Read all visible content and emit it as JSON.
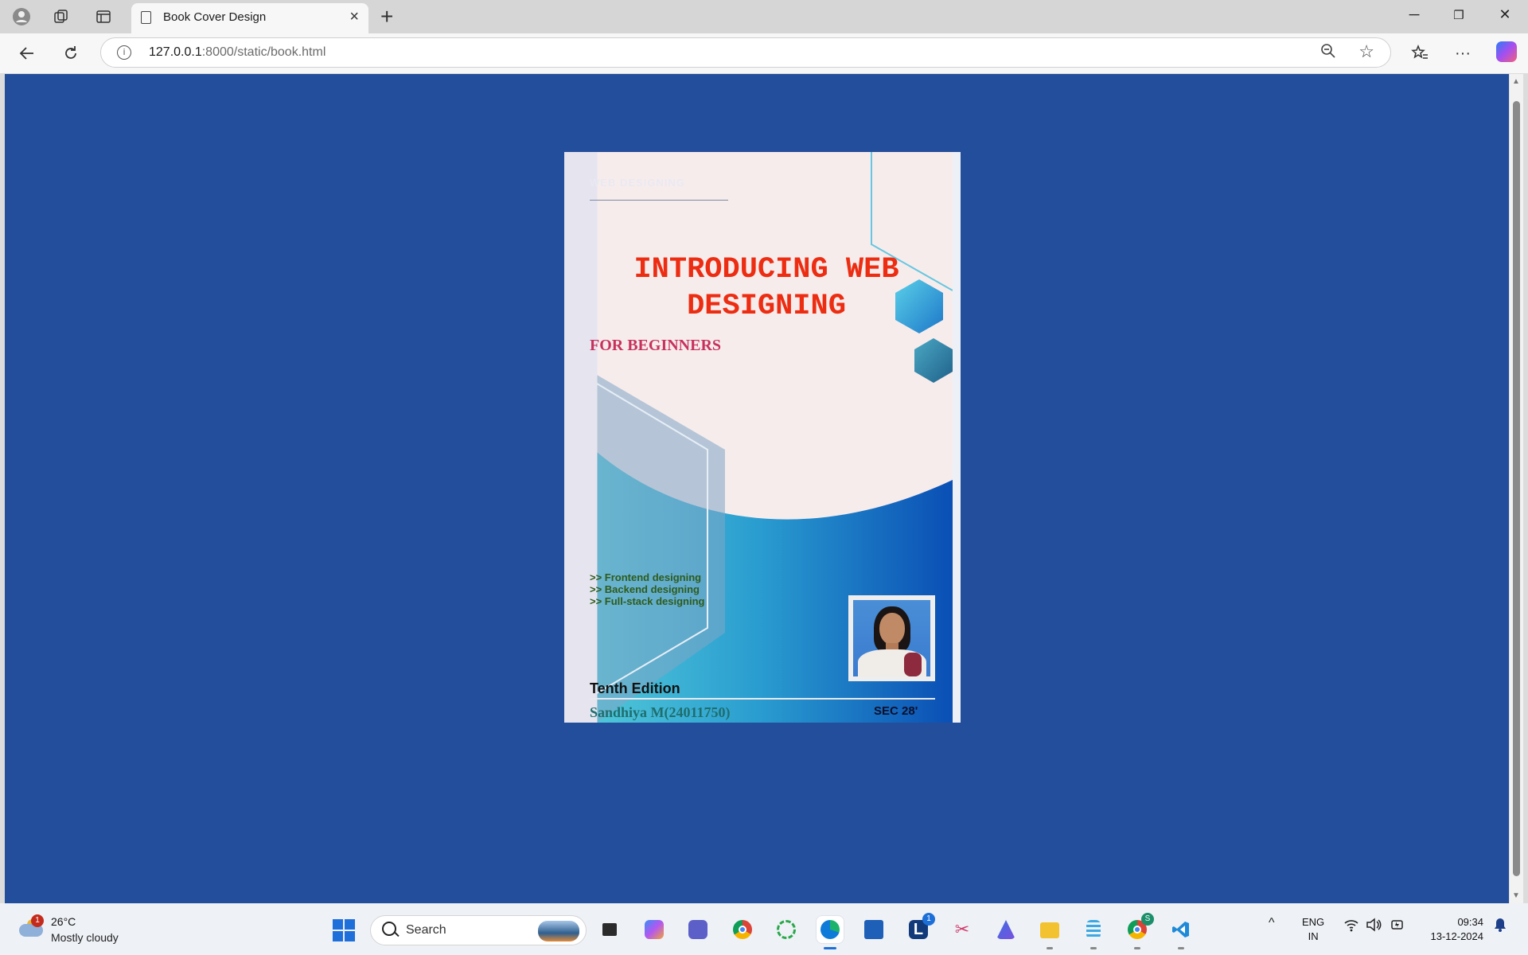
{
  "browser": {
    "tab_title": "Book Cover Design",
    "url_host": "127.0.0.1",
    "url_path": ":8000/static/book.html"
  },
  "colors": {
    "page_background": "#234e9b",
    "title_color": "#ec2d12",
    "subtitle_color": "#c7325c",
    "cover_background": "#f7ecec"
  },
  "cover": {
    "series_label": "WEB DESIGNING",
    "title_line1": "INTRODUCING WEB",
    "title_line2": "DESIGNING",
    "subtitle": "FOR BEGINNERS",
    "topics": [
      ">> Frontend designing",
      ">> Backend designing",
      ">> Full-stack designing"
    ],
    "edition": "Tenth Edition",
    "author": "Sandhiya M(24011750)",
    "section": "SEC 28'"
  },
  "taskbar": {
    "weather_badge": "1",
    "temperature": "26°C",
    "condition": "Mostly cloudy",
    "search_label": "Search",
    "apps": [
      {
        "name": "task-view",
        "icon": "task-view-icon"
      },
      {
        "name": "copilot",
        "icon": "copilot-icon"
      },
      {
        "name": "teams",
        "icon": "teams-icon"
      },
      {
        "name": "chrome",
        "icon": "chrome-icon"
      },
      {
        "name": "recorder",
        "icon": "circle-icon"
      },
      {
        "name": "edge",
        "icon": "edge-icon"
      },
      {
        "name": "store",
        "icon": "store-icon"
      },
      {
        "name": "launcher",
        "icon": "l-icon"
      },
      {
        "name": "snipping-tool",
        "icon": "scissors-icon"
      },
      {
        "name": "app",
        "icon": "triangle-icon"
      },
      {
        "name": "file-explorer",
        "icon": "folder-icon"
      },
      {
        "name": "notepad",
        "icon": "notepad-icon"
      },
      {
        "name": "chrome-profile",
        "icon": "chrome-icon"
      },
      {
        "name": "vscode",
        "icon": "vscode-icon"
      }
    ],
    "launcher_badge": "1",
    "chrome_badge": "S",
    "lang_line1": "ENG",
    "lang_line2": "IN",
    "time": "09:34",
    "date": "13-12-2024"
  }
}
